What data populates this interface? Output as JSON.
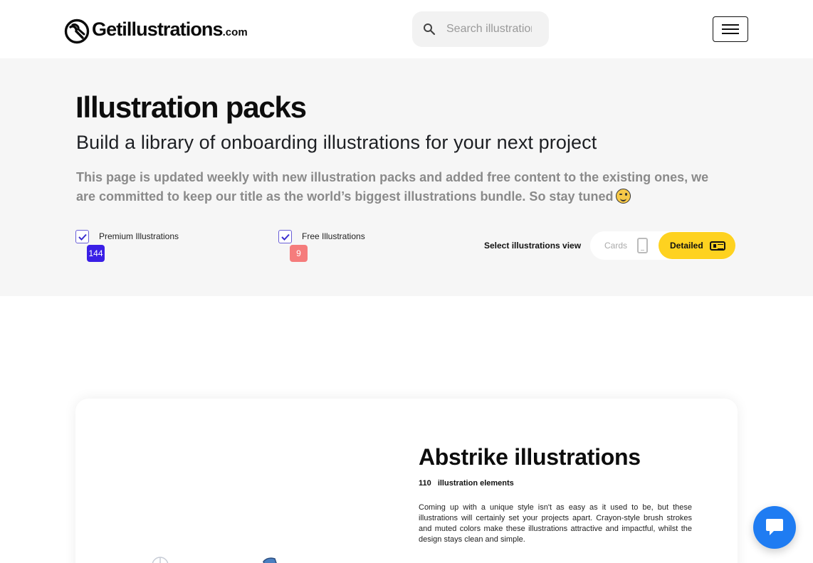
{
  "header": {
    "logo_text": "Getillustrations",
    "logo_suffix": ".com",
    "search_placeholder": "Search illustrations",
    "menu_icon": "hamburger-icon"
  },
  "hero": {
    "title": "Illustration packs",
    "subtitle": "Build a library of onboarding illustrations for your next project",
    "description": "This page is updated weekly with new illustration packs and added free content to the existing ones, we are committed to keep our title as the world’s biggest illustrations bundle. So stay tuned",
    "emoji_icon": "winking-face-icon"
  },
  "filters": [
    {
      "label": "Premium Illustrations",
      "count": "144",
      "checked": true,
      "badge_color": "#3a1fe6"
    },
    {
      "label": "Free Illustrations",
      "count": "9",
      "checked": true,
      "badge_color": "#f57c7c"
    }
  ],
  "view_selector": {
    "label": "Select illustrations view",
    "options": [
      {
        "label": "Cards",
        "icon": "phone-icon",
        "active": false
      },
      {
        "label": "Detailed",
        "icon": "card-icon",
        "active": true
      }
    ],
    "accent": "#fed220"
  },
  "pack": {
    "title": "Abstrike illustrations",
    "count": "110",
    "count_label": "illustration elements",
    "description": "Coming up with a unique style isn't as easy as it used to be, but these illustrations will certainly set your projects apart. Crayon-style brush strokes and muted colors make these illustrations attractive and impactful, whilst the design stays clean and simple."
  },
  "chat": {
    "icon": "chat-bubble-icon",
    "color": "#1f7cf2"
  }
}
